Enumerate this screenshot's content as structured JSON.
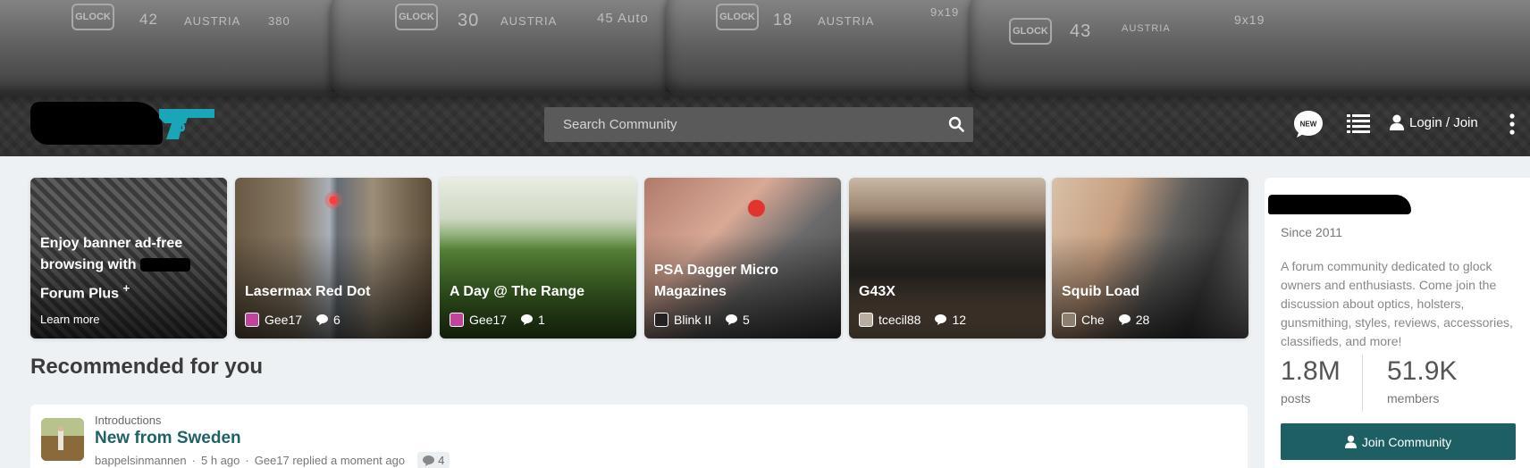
{
  "header": {
    "slide_engravings": [
      {
        "brand": "GLOCK",
        "model": "42",
        "country": "AUSTRIA",
        "caliber": "380"
      },
      {
        "brand": "GLOCK",
        "model": "30",
        "country": "AUSTRIA",
        "caliber": "45 Auto"
      },
      {
        "brand": "GLOCK",
        "model": "18",
        "country": "AUSTRIA",
        "caliber": "9x19"
      },
      {
        "brand": "GLOCK",
        "model": "43",
        "country": "AUSTRIA",
        "caliber": "9x19"
      }
    ],
    "search_placeholder": "Search Community",
    "new_badge": "NEW",
    "login_label": "Login / Join",
    "logo_gun_color": "#19a6b8"
  },
  "cards": [
    {
      "title_line1": "Enjoy banner ad-free",
      "title_line2": "browsing with",
      "title_line3": "Forum Plus",
      "plus_mark": "+",
      "learn_more": "Learn more"
    },
    {
      "title": "Lasermax Red Dot",
      "author": "Gee17",
      "replies": "6"
    },
    {
      "title": "A Day @ The Range",
      "author": "Gee17",
      "replies": "1"
    },
    {
      "title": "PSA Dagger Micro Magazines",
      "author": "Blink II",
      "replies": "5"
    },
    {
      "title": "G43X",
      "author": "tcecil88",
      "replies": "12"
    },
    {
      "title": "Squib Load",
      "author": "Che",
      "replies": "28"
    }
  ],
  "recommended": {
    "heading": "Recommended for you",
    "thread": {
      "category": "Introductions",
      "title": "New from Sweden",
      "author": "bappelsinmannen",
      "posted": "5 h ago",
      "last_reply": "Gee17 replied a moment ago",
      "separator": "·",
      "replies": "4"
    }
  },
  "sidebar": {
    "since": "Since 2011",
    "description": "A forum community dedicated to glock owners and enthusiasts. Come join the discussion about optics, holsters, gunsmithing, styles, reviews, accessories, classifieds, and more!",
    "posts_value": "1.8M",
    "posts_label": "posts",
    "members_value": "51.9K",
    "members_label": "members",
    "join_label": "Join Community",
    "accent": "#1d5f62"
  }
}
